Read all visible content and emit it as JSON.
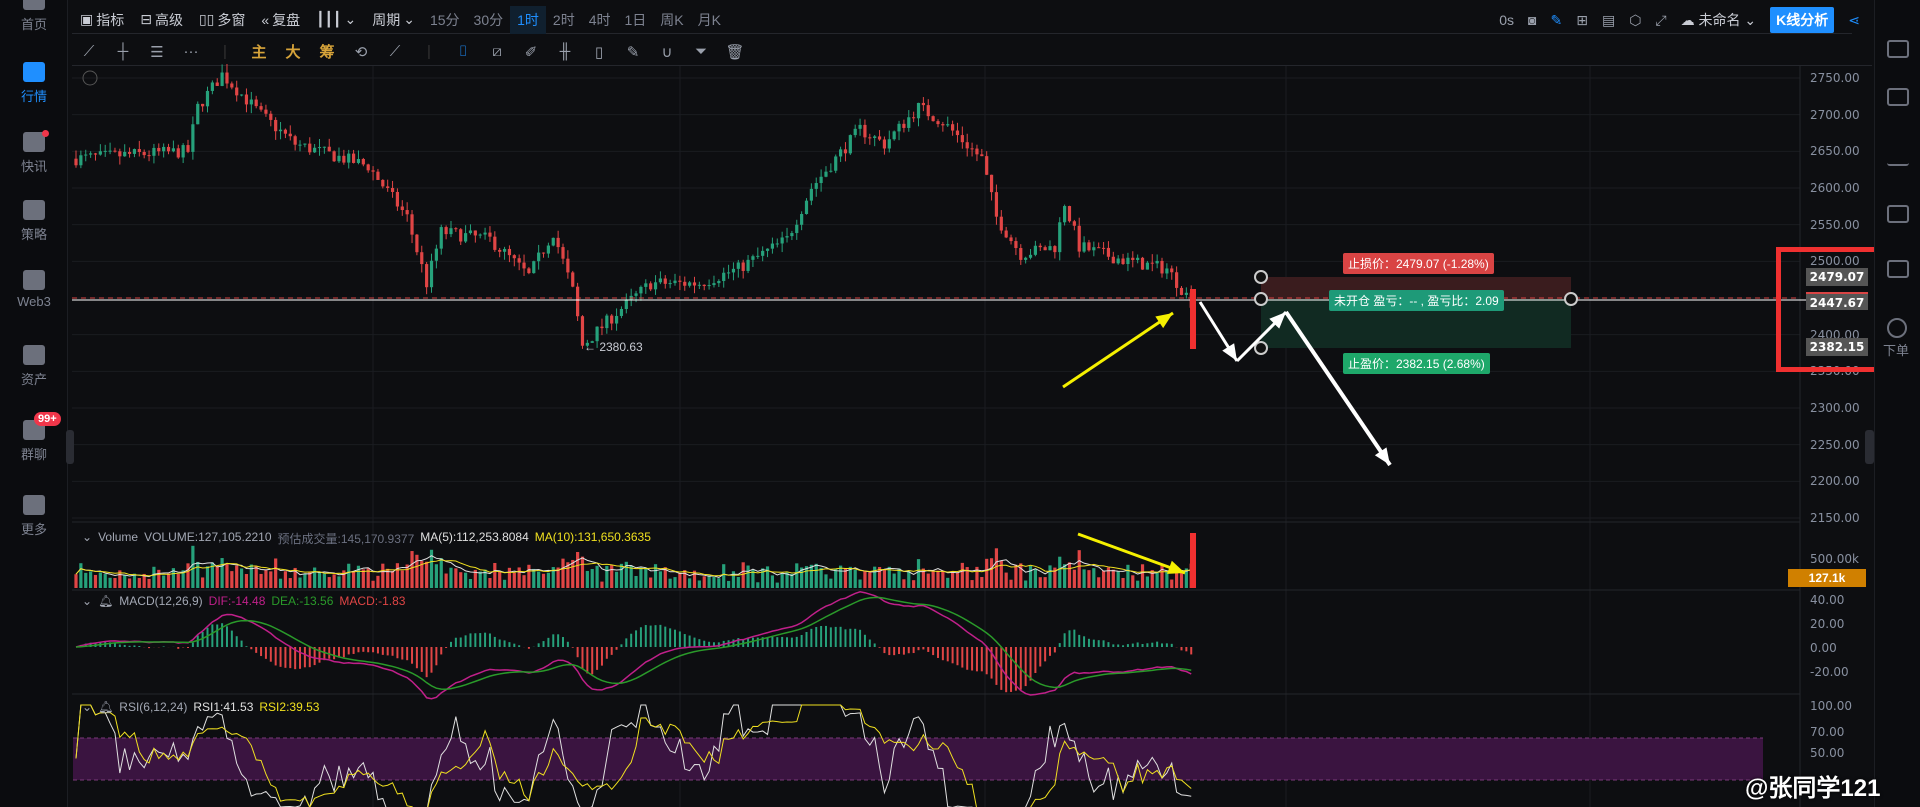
{
  "sidebar": {
    "items": [
      {
        "label": "首页",
        "icon": "home-icon"
      },
      {
        "label": "行情",
        "icon": "market-icon",
        "active": true
      },
      {
        "label": "快讯",
        "icon": "news-icon",
        "dot": true
      },
      {
        "label": "策略",
        "icon": "robot-icon"
      },
      {
        "label": "Web3",
        "icon": "web3-icon"
      },
      {
        "label": "资产",
        "icon": "wallet-icon"
      },
      {
        "label": "群聊",
        "icon": "chat-icon",
        "badge": "99+"
      },
      {
        "label": "更多",
        "icon": "more-icon"
      }
    ]
  },
  "toolbar": {
    "indicators": "指标",
    "advanced": "高级",
    "multi_window": "多窗",
    "replay": "复盘",
    "period": "周期",
    "periods": [
      "15分",
      "30分",
      "1时",
      "2时",
      "4时",
      "1日",
      "周K",
      "月K"
    ],
    "active_period": "1时",
    "timer": "0s",
    "layout_name": "未命名",
    "kline_analysis": "K线分析"
  },
  "drawing_toolbar": {
    "main": "主",
    "big": "大",
    "chips": "筹"
  },
  "chart": {
    "low_label": "← 2380.63",
    "price_axis": [
      "2750.00",
      "2700.00",
      "2650.00",
      "2600.00",
      "2550.00",
      "2500.00",
      "2450.00",
      "2400.00",
      "2350.00",
      "2300.00",
      "2250.00",
      "2200.00",
      "2150.00"
    ],
    "price_tags": {
      "stop_loss": "2479.07",
      "current": "2447.67",
      "take_profit": "2382.15"
    },
    "order": {
      "stop_loss_label": "止损价：2479.07 (-1.28%)",
      "status_label": "未开仓  盈亏：-- , 盈亏比：2.09",
      "take_profit_label": "止盈价：2382.15 (2.68%)"
    },
    "anchors": [
      [
        0,
        2640
      ],
      [
        10,
        2645
      ],
      [
        23,
        2650
      ],
      [
        25,
        2710
      ],
      [
        30,
        2755
      ],
      [
        38,
        2700
      ],
      [
        45,
        2660
      ],
      [
        60,
        2630
      ],
      [
        68,
        2560
      ],
      [
        72,
        2470
      ],
      [
        75,
        2540
      ],
      [
        85,
        2530
      ],
      [
        93,
        2480
      ],
      [
        98,
        2540
      ],
      [
        102,
        2460
      ],
      [
        104,
        2385
      ],
      [
        111,
        2430
      ],
      [
        118,
        2470
      ],
      [
        128,
        2470
      ],
      [
        136,
        2490
      ],
      [
        146,
        2530
      ],
      [
        151,
        2600
      ],
      [
        161,
        2680
      ],
      [
        166,
        2660
      ],
      [
        173,
        2710
      ],
      [
        178,
        2690
      ],
      [
        186,
        2640
      ],
      [
        189,
        2560
      ],
      [
        194,
        2510
      ],
      [
        201,
        2520
      ],
      [
        203,
        2580
      ],
      [
        206,
        2520
      ],
      [
        216,
        2500
      ],
      [
        224,
        2490
      ],
      [
        229,
        2445
      ]
    ],
    "colors": {
      "up": "#26a17b",
      "down": "#e04545",
      "ma5": "#e0e0e0",
      "ma10": "#f0e020",
      "dif": "#c0208a",
      "dea": "#2a9a2a"
    }
  },
  "volume": {
    "name": "Volume",
    "volume": "VOLUME:127,105.2210",
    "estimated": "预估成交量:145,170.9377",
    "ma5": "MA(5):112,253.8084",
    "ma10": "MA(10):131,650.3635",
    "axis": "500.00k",
    "tag": "127.1k"
  },
  "macd": {
    "name": "MACD(12,26,9)",
    "dif": "DIF:-14.48",
    "dea": "DEA:-13.56",
    "macd": "MACD:-1.83",
    "axis": [
      "40.00",
      "20.00",
      "0.00",
      "-20.00"
    ]
  },
  "rsi": {
    "name": "RSI(6,12,24)",
    "rsi1": "RSI1:41.53",
    "rsi2": "RSI2:39.53",
    "axis": [
      "100.00",
      "70.00",
      "50.00"
    ]
  },
  "right_panel": {
    "order_label": "下单"
  },
  "watermark": "@张同学121"
}
